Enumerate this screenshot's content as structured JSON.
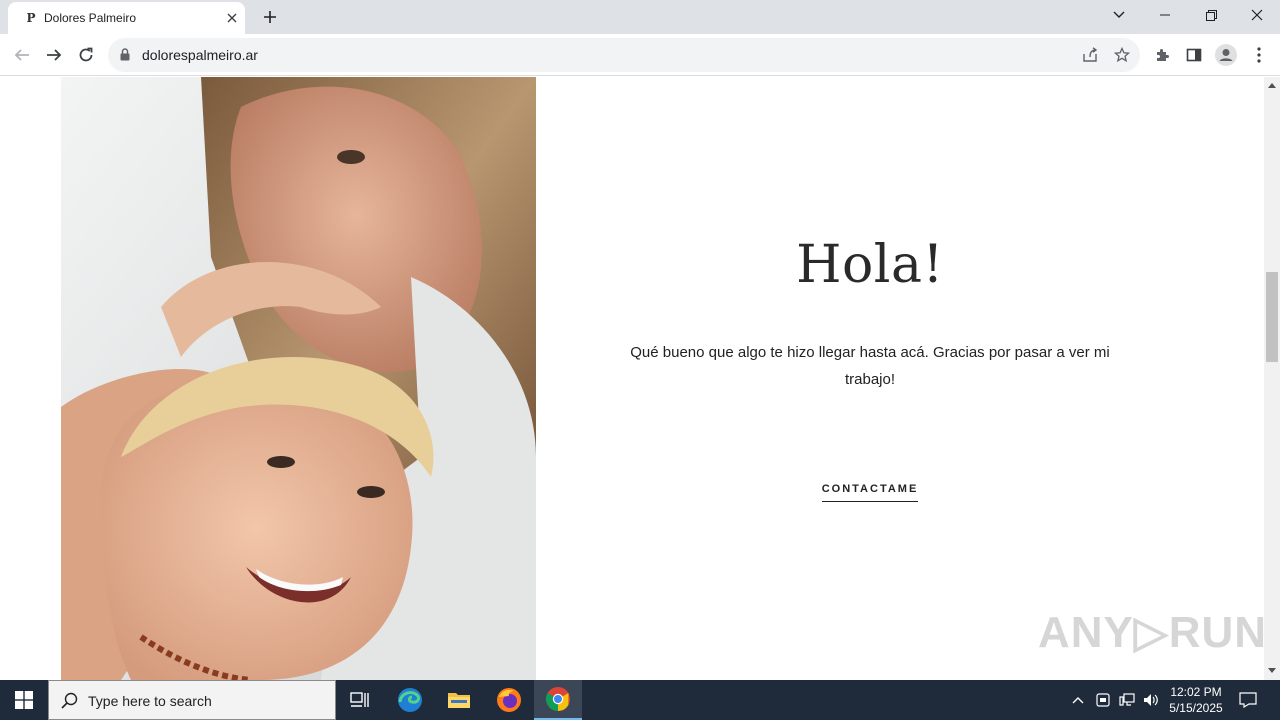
{
  "browser": {
    "tab_favicon": "P",
    "tab_title": "Dolores Palmeiro",
    "url": "dolorespalmeiro.ar"
  },
  "page": {
    "heading": "Hola!",
    "intro": "Qué bueno que algo te hizo llegar hasta acá. Gracias por pasar a ver mi trabajo!",
    "cta_label": "CONTACTAME",
    "photo_alt": "Mother and laughing child portrait"
  },
  "watermark": "ANY RUN",
  "taskbar": {
    "search_placeholder": "Type here to search",
    "apps": [
      "task-view",
      "edge",
      "file-explorer",
      "firefox",
      "chrome"
    ],
    "time": "12:02 PM",
    "date": "5/15/2025"
  },
  "colors": {
    "tabstrip": "#dee1e6",
    "taskbar": "#1f2a3a",
    "text": "#222222"
  }
}
